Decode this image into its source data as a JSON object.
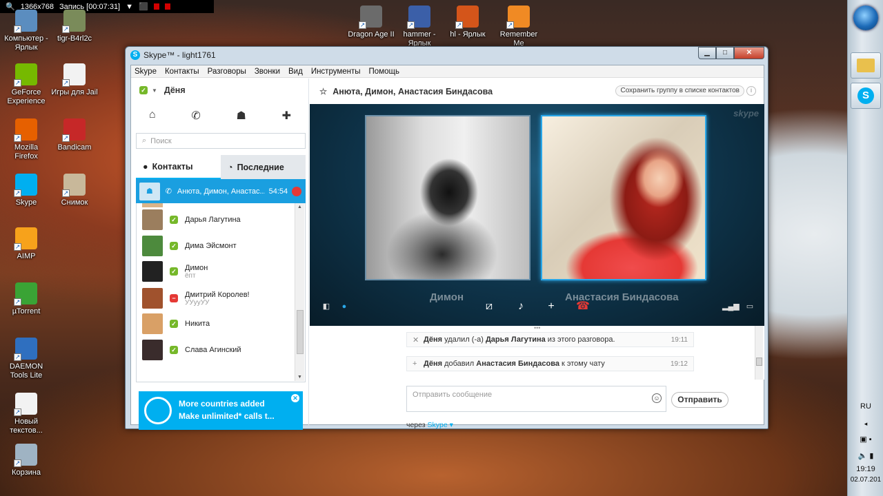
{
  "recorder": {
    "resolution": "1366x768",
    "record_label": "Запись [00:07:31]"
  },
  "desktop": {
    "icons": [
      {
        "label": "Компьютер -\nЯрлык",
        "color": "#5b8dbf"
      },
      {
        "label": "tigr-B4rl2c",
        "color": "#7a8b5a"
      },
      {
        "label": "GeForce\nExperience",
        "color": "#76b900"
      },
      {
        "label": "Игры для Jail",
        "color": "#f2f2f2"
      },
      {
        "label": "Mozilla\nFirefox",
        "color": "#e66000"
      },
      {
        "label": "Bandicam",
        "color": "#c62828"
      },
      {
        "label": "Skype",
        "color": "#00aff0"
      },
      {
        "label": "Снимок",
        "color": "#c8b89a"
      },
      {
        "label": "AIMP",
        "color": "#f7a21b"
      },
      {
        "label": "µTorrent",
        "color": "#3aa335"
      },
      {
        "label": "DAEMON\nTools Lite",
        "color": "#2f6fbf"
      },
      {
        "label": "Новый\nтекстов...",
        "color": "#f2f2f2"
      },
      {
        "label": "Корзина",
        "color": "#9fb3c3"
      },
      {
        "label": "Dragon Age II",
        "color": "#6b6b6b"
      },
      {
        "label": "hammer -\nЯрлык",
        "color": "#3b5fa8"
      },
      {
        "label": "hl - Ярлык",
        "color": "#d4551a"
      },
      {
        "label": "Remember\nMe",
        "color": "#f08a24"
      }
    ]
  },
  "taskbar": {
    "lang": "RU",
    "time": "19:19",
    "date": "02.07.201"
  },
  "window": {
    "title": "Skype™ - light1761",
    "menu": [
      "Skype",
      "Контакты",
      "Разговоры",
      "Звонки",
      "Вид",
      "Инструменты",
      "Помощь"
    ],
    "user_name": "Дёня",
    "search_placeholder": "Поиск",
    "tabs": {
      "contacts": "Контакты",
      "recent": "Последние"
    },
    "active_call": {
      "name": "Анюта, Димон, Анастас...",
      "duration": "54:54"
    },
    "contacts": [
      {
        "name": "Дарья Лагутина",
        "mood": "",
        "status": "online",
        "avatar": "#9b7e5e"
      },
      {
        "name": "Дима Эйсмонт",
        "mood": "",
        "status": "online",
        "avatar": "#4d8a3d"
      },
      {
        "name": "Димон",
        "mood": "ёпт",
        "status": "online",
        "avatar": "#222222"
      },
      {
        "name": "Дмитрий Королев!",
        "mood": "УУууУУ",
        "status": "busy",
        "avatar": "#a0522d"
      },
      {
        "name": "Никита",
        "mood": "",
        "status": "online",
        "avatar": "#d9a066"
      },
      {
        "name": "Слава Агинский",
        "mood": "",
        "status": "online",
        "avatar": "#3a2c2c"
      }
    ],
    "promo": {
      "line1": "More countries added",
      "line2": "Make unlimited* calls t..."
    },
    "conversation": {
      "title": "Анюта, Димон, Анастасия Биндасова",
      "save_group": "Сохранить группу в списке контактов",
      "participant1": "Димон",
      "participant2": "Анастасия Биндасова",
      "messages": [
        {
          "symbol": "✕",
          "actor": "Дёня",
          "text1": " удалил (-а) ",
          "target": "Дарья Лагутина",
          "text2": " из этого разговора.",
          "time": "19:11"
        },
        {
          "symbol": "+",
          "actor": "Дёня",
          "text1": " добавил ",
          "target": "Анастасия Биндасова",
          "text2": " к этому чату",
          "time": "19:12"
        }
      ],
      "compose_placeholder": "Отправить сообщение",
      "send_label": "Отправить",
      "via_label": "через",
      "via_value": "Skype ▾"
    }
  }
}
